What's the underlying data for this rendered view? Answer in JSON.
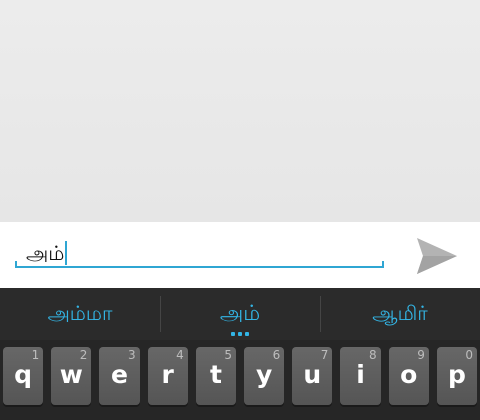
{
  "compose": {
    "input_value": "அம்",
    "send_icon": "send-icon"
  },
  "suggestions": [
    {
      "label": "அம்மா"
    },
    {
      "label": "அம்"
    },
    {
      "label": "ஆமிர்"
    }
  ],
  "keyboard": {
    "row1": [
      {
        "letter": "q",
        "hint": "1"
      },
      {
        "letter": "w",
        "hint": "2"
      },
      {
        "letter": "e",
        "hint": "3"
      },
      {
        "letter": "r",
        "hint": "4"
      },
      {
        "letter": "t",
        "hint": "5"
      },
      {
        "letter": "y",
        "hint": "6"
      },
      {
        "letter": "u",
        "hint": "7"
      },
      {
        "letter": "i",
        "hint": "8"
      },
      {
        "letter": "o",
        "hint": "9"
      },
      {
        "letter": "p",
        "hint": "0"
      }
    ]
  },
  "colors": {
    "accent": "#33b5e5",
    "input_underline": "#2fa6d3",
    "keyboard_bg": "#262626",
    "key_bg": "#5e5e5e",
    "send_icon": "#b3b3b3"
  }
}
